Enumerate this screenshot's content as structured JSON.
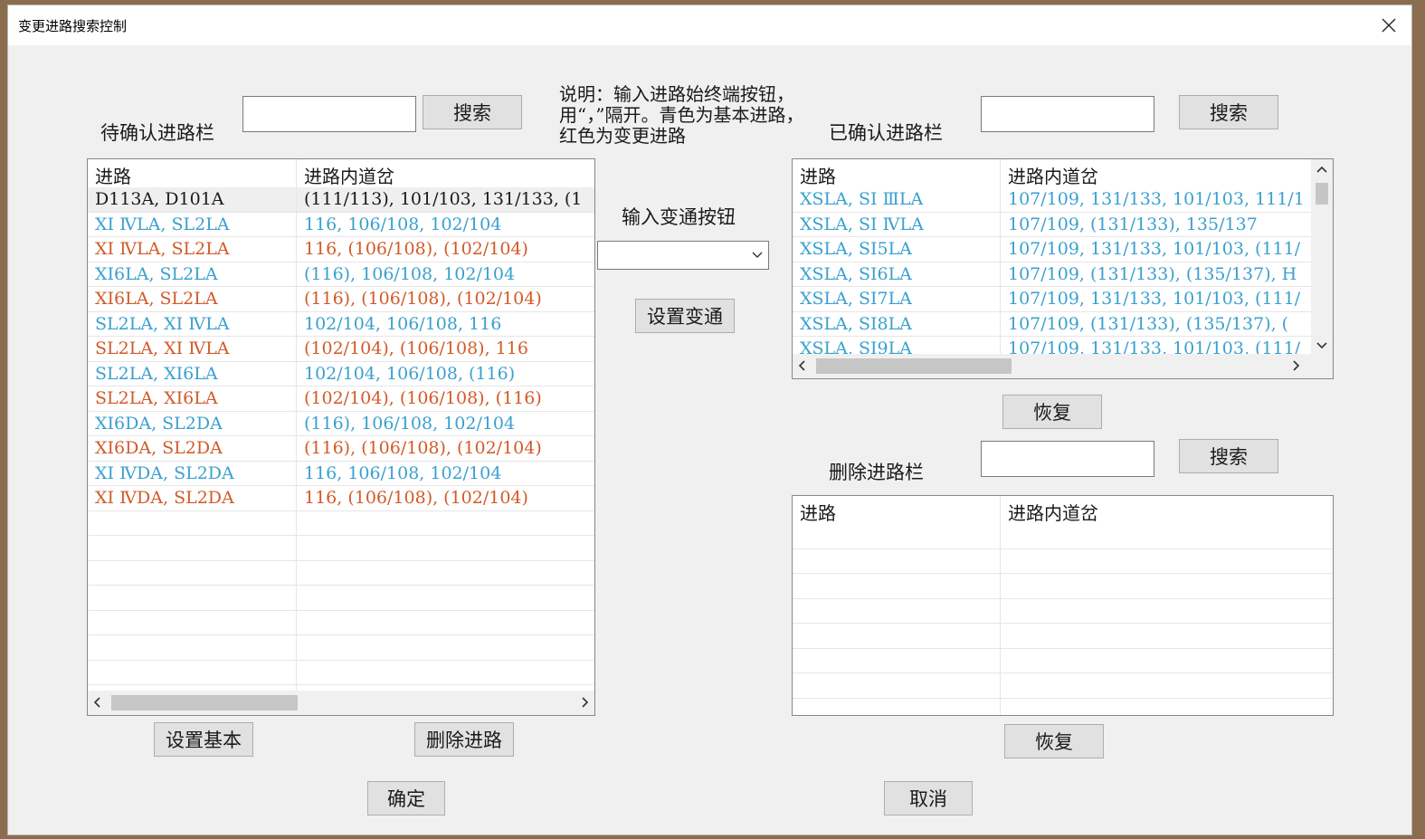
{
  "window": {
    "title": "变更进路搜索控制",
    "close_icon": "close-icon"
  },
  "pending": {
    "label": "待确认进路栏",
    "search_value": "",
    "search_button": "搜索",
    "columns": [
      "进路",
      "进路内道岔"
    ],
    "rows": [
      {
        "route": "D113A, D101A",
        "switches": "(111/113), 101/103, 131/133, (1",
        "color": "black"
      },
      {
        "route": "XⅠ  ⅣLA, SL2LA",
        "switches": "116, 106/108, 102/104",
        "color": "cyan"
      },
      {
        "route": "XⅠ  ⅣLA, SL2LA",
        "switches": "116, (106/108), (102/104)",
        "color": "red"
      },
      {
        "route": "XⅠ6LA, SL2LA",
        "switches": "(116), 106/108, 102/104",
        "color": "cyan"
      },
      {
        "route": "XⅠ6LA, SL2LA",
        "switches": "(116), (106/108), (102/104)",
        "color": "red"
      },
      {
        "route": "SL2LA, XⅠ  ⅣLA",
        "switches": "102/104, 106/108, 116",
        "color": "cyan"
      },
      {
        "route": "SL2LA, XⅠ  ⅣLA",
        "switches": "(102/104), (106/108), 116",
        "color": "red"
      },
      {
        "route": "SL2LA, XⅠ6LA",
        "switches": "102/104, 106/108, (116)",
        "color": "cyan"
      },
      {
        "route": "SL2LA, XⅠ6LA",
        "switches": "(102/104), (106/108), (116)",
        "color": "red"
      },
      {
        "route": "XⅠ6DA, SL2DA",
        "switches": "(116), 106/108, 102/104",
        "color": "cyan"
      },
      {
        "route": "XⅠ6DA, SL2DA",
        "switches": "(116), (106/108), (102/104)",
        "color": "red"
      },
      {
        "route": "XⅠ  ⅣDA, SL2DA",
        "switches": "116, 106/108, 102/104",
        "color": "cyan"
      },
      {
        "route": "XⅠ  ⅣDA, SL2DA",
        "switches": "116, (106/108), (102/104)",
        "color": "red"
      }
    ],
    "set_basic_button": "设置基本",
    "delete_route_button": "删除进路"
  },
  "middle": {
    "description": "说明：输入进路始终端按钮，用“，”隔开。青色为基本进路，红色为变更进路",
    "input_label": "输入变通按钮",
    "select_value": "",
    "set_variant_button": "设置变通"
  },
  "confirmed": {
    "label": "已确认进路栏",
    "search_value": "",
    "search_button": "搜索",
    "columns": [
      "进路",
      "进路内道岔"
    ],
    "rows": [
      {
        "route": "XSLA, SⅠ  ⅢLA",
        "switches": "107/109, 131/133, 101/103, 111/1",
        "color": "cyan"
      },
      {
        "route": "XSLA, SⅠ  ⅣLA",
        "switches": "107/109, (131/133), 135/137",
        "color": "cyan"
      },
      {
        "route": "XSLA, SⅠ5LA",
        "switches": "107/109, 131/133, 101/103, (111/",
        "color": "cyan"
      },
      {
        "route": "XSLA, SⅠ6LA",
        "switches": "107/109, (131/133), (135/137), H",
        "color": "cyan"
      },
      {
        "route": "XSLA, SⅠ7LA",
        "switches": "107/109, 131/133, 101/103, (111/",
        "color": "cyan"
      },
      {
        "route": "XSLA, SⅠ8LA",
        "switches": "107/109, (131/133), (135/137), (",
        "color": "cyan"
      },
      {
        "route": "XSLA, SⅠ9LA",
        "switches": "107/109, 131/133, 101/103, (111/",
        "color": "cyan"
      }
    ],
    "restore_button": "恢复"
  },
  "deleted": {
    "label": "删除进路栏",
    "search_value": "",
    "search_button": "搜索",
    "columns": [
      "进路",
      "进路内道岔"
    ],
    "rows": [],
    "restore_button": "恢复"
  },
  "footer": {
    "ok_button": "确定",
    "cancel_button": "取消"
  },
  "colors": {
    "cyan": "#3aa0cf",
    "red": "#d25a28",
    "black": "#1a1a1a"
  }
}
